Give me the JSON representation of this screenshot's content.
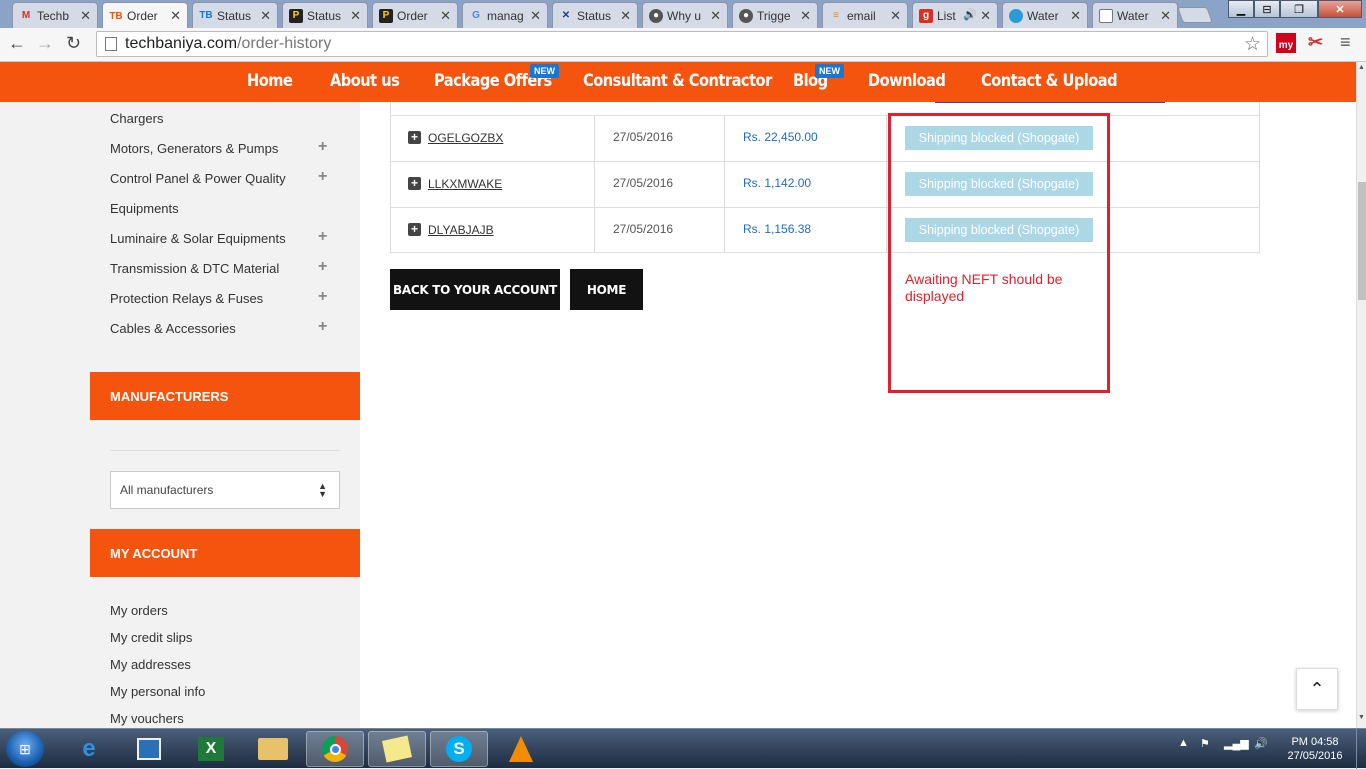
{
  "browser": {
    "tabs": [
      {
        "title": "Techb",
        "icon": "gmail-icon"
      },
      {
        "title": "Order",
        "icon": "techbaniya-icon",
        "active": true
      },
      {
        "title": "Status",
        "icon": "techbaniya-icon"
      },
      {
        "title": "Status",
        "icon": "prestashop-icon"
      },
      {
        "title": "Order",
        "icon": "prestashop-icon"
      },
      {
        "title": "manag",
        "icon": "google-icon"
      },
      {
        "title": "Status",
        "icon": "x-tool-icon"
      },
      {
        "title": "Why u",
        "icon": "github-icon"
      },
      {
        "title": "Trigge",
        "icon": "github-icon"
      },
      {
        "title": "email",
        "icon": "stackoverflow-icon"
      },
      {
        "title": "List",
        "icon": "g-red-icon"
      },
      {
        "title": "Water",
        "icon": "water-drop-icon"
      },
      {
        "title": "Water",
        "icon": "document-icon"
      }
    ],
    "url_host": "techbaniya.com",
    "url_path": "/order-history",
    "extension_label": "my"
  },
  "site_nav": {
    "items": [
      "Home",
      "About us",
      "Package Offers",
      "Consultant & Contractor",
      "Blog",
      "Download",
      "Contact & Upload"
    ],
    "new_badge": "NEW"
  },
  "sidebar": {
    "categories": [
      "Chargers",
      "Motors, Generators & Pumps",
      "Control Panel & Power Quality",
      "Equipments",
      "Luminaire & Solar Equipments",
      "Transmission & DTC Material",
      "Protection Relays & Fuses",
      "Cables & Accessories"
    ],
    "manufacturers_heading": "MANUFACTURERS",
    "manufacturers_select": "All manufacturers",
    "account_heading": "MY ACCOUNT",
    "account_links": [
      "My orders",
      "My credit slips",
      "My addresses",
      "My personal info",
      "My vouchers"
    ]
  },
  "orders": [
    {
      "reference": "OGELGOZBX",
      "date": "27/05/2016",
      "total": "Rs. 22,450.00",
      "status": "Shipping blocked (Shopgate)"
    },
    {
      "reference": "LLKXMWAKE",
      "date": "27/05/2016",
      "total": "Rs. 1,142.00",
      "status": "Shipping blocked (Shopgate)"
    },
    {
      "reference": "DLYABJAJB",
      "date": "27/05/2016",
      "total": "Rs. 1,156.38",
      "status": "Shipping blocked (Shopgate)"
    }
  ],
  "buttons": {
    "back": "BACK TO YOUR ACCOUNT",
    "home": "HOME"
  },
  "annotation": "Awaiting NEFT should be displayed",
  "taskbar": {
    "time": "PM 04:58",
    "date": "27/05/2016"
  },
  "colors": {
    "brand_orange": "#f5540e",
    "status_bg": "#acd8e6",
    "annotation_red": "#e0202c",
    "price_blue": "#1e6bc4"
  }
}
